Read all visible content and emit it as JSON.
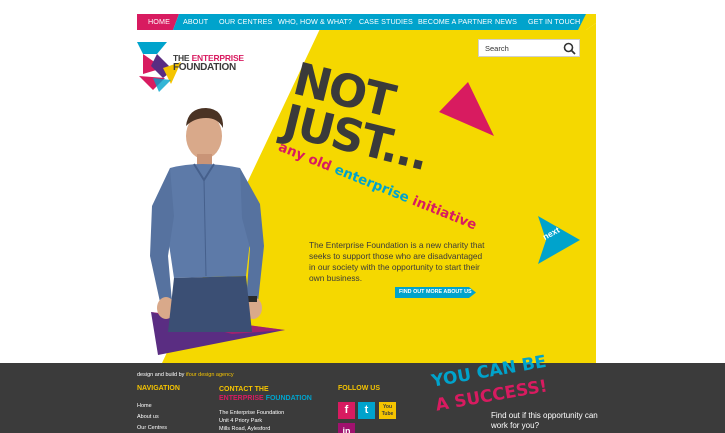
{
  "nav": {
    "items": [
      {
        "label": "HOME",
        "active": true
      },
      {
        "label": "ABOUT"
      },
      {
        "label": "OUR CENTRES"
      },
      {
        "label": "WHO, HOW & WHAT?"
      },
      {
        "label": "CASE STUDIES"
      },
      {
        "label": "BECOME A PARTNER"
      },
      {
        "label": "NEWS"
      },
      {
        "label": "GET IN TOUCH"
      }
    ]
  },
  "search": {
    "placeholder": "Search",
    "icon": "magnifier-icon"
  },
  "logo": {
    "the": "THE",
    "enterprise": "ENTERPRISE",
    "foundation": "FOUNDATION"
  },
  "hero": {
    "headline_1": "NOT",
    "headline_2": "JUST...",
    "tagline_1": "any old",
    "tagline_2": "enterprise",
    "tagline_3": "initiative",
    "intro": "The Enterprise Foundation is a new charity that seeks to support those who are disadvantaged in our society with the opportunity to start their own business.",
    "find_out": "FIND OUT MORE ABOUT US",
    "next": "next"
  },
  "footer": {
    "credit_prefix": "design and build by",
    "credit_agency": "ifour design agency",
    "navigation_title": "NAVIGATION",
    "nav_links": [
      "Home",
      "About us",
      "Our Centres"
    ],
    "contact_title_1": "CONTACT THE",
    "contact_title_2": "ENTERPRISE",
    "contact_title_3": "FOUNDATION",
    "address": [
      "The Enterprise Foundation",
      "Unit 4 Priory Park",
      "Mills Road, Aylesford"
    ],
    "follow_title": "FOLLOW US",
    "social": [
      {
        "label": "f",
        "icon": "facebook-icon",
        "color": "#d81b60"
      },
      {
        "label": "t",
        "icon": "twitter-icon",
        "color": "#00a3cc"
      },
      {
        "label": "You Tube",
        "icon": "youtube-icon",
        "color": "#f5c400"
      },
      {
        "label": "in",
        "icon": "linkedin-icon",
        "color": "#a0126e"
      }
    ],
    "success_1": "YOU CAN BE",
    "success_2": "A SUCCESS!",
    "success_text": "Find out if this opportunity can work for you?"
  },
  "colors": {
    "yellow": "#f5d800",
    "magenta": "#d81b60",
    "cyan": "#00a3cc",
    "dark": "#3b3b3b",
    "purple": "#5a2d82"
  }
}
